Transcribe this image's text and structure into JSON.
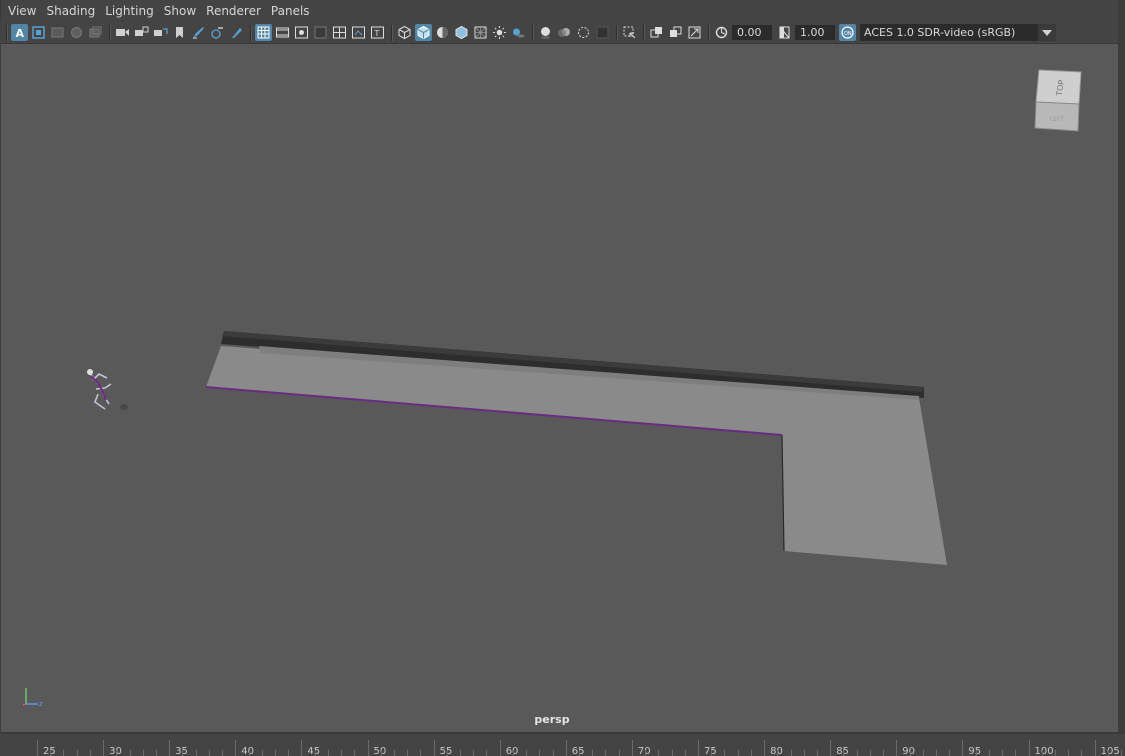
{
  "menu": {
    "view": "View",
    "shading": "Shading",
    "lighting": "Lighting",
    "show": "Show",
    "renderer": "Renderer",
    "panels": "Panels"
  },
  "toolbar": {
    "exposure_value": "0.00",
    "gamma_value": "1.00",
    "color_space": "ACES 1.0 SDR-video (sRGB)",
    "active_color": "#5285a6"
  },
  "viewport": {
    "camera_label": "persp",
    "background_color": "#595959",
    "view_cube_top": "TOP",
    "view_cube_side": "LEFT"
  },
  "timeline": {
    "ticks": [
      "25",
      "30",
      "35",
      "40",
      "45",
      "50",
      "55",
      "60",
      "65",
      "70",
      "75",
      "80",
      "85",
      "90",
      "95",
      "100",
      "105"
    ]
  }
}
